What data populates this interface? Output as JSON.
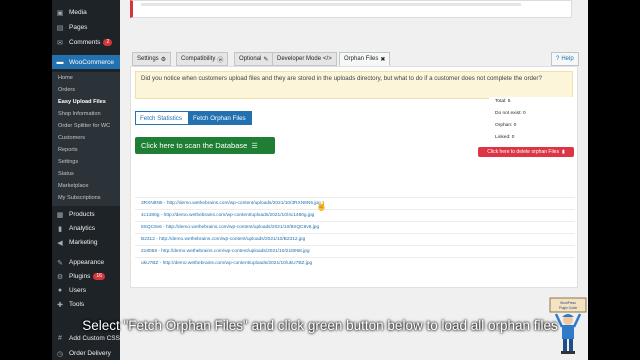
{
  "sidebar": {
    "items": [
      {
        "label": "Media",
        "icon": "media-icon"
      },
      {
        "label": "Pages",
        "icon": "pages-icon"
      },
      {
        "label": "Comments",
        "icon": "comments-icon",
        "badge": "2"
      },
      {
        "label": "WooCommerce",
        "icon": "woocommerce-icon"
      },
      {
        "label": "Products",
        "icon": "products-icon"
      },
      {
        "label": "Analytics",
        "icon": "analytics-icon"
      },
      {
        "label": "Marketing",
        "icon": "marketing-icon"
      },
      {
        "label": "Appearance",
        "icon": "appearance-icon"
      },
      {
        "label": "Plugins",
        "icon": "plugins-icon",
        "badge": "16"
      },
      {
        "label": "Users",
        "icon": "users-icon"
      },
      {
        "label": "Tools",
        "icon": "tools-icon"
      },
      {
        "label": "Add Custom CSS",
        "icon": "css-icon"
      },
      {
        "label": "Order Delivery",
        "icon": "delivery-icon"
      }
    ],
    "submenu": [
      "Home",
      "Orders",
      "Easy Upload Files",
      "Shop Information",
      "Order Splitter for WC",
      "Customers",
      "Reports",
      "Settings",
      "Status",
      "Marketplace",
      "My Subscriptions"
    ]
  },
  "tabs": [
    {
      "label": "Settings",
      "icon": "settings-gear-icon"
    },
    {
      "label": "Compatibility",
      "icon": "wordpress-icon"
    },
    {
      "label": "Optional",
      "icon": "edit-icon"
    },
    {
      "label": "Developer Mode",
      "icon": "code-icon"
    },
    {
      "label": "Orphan Files",
      "icon": "crossed-file-icon"
    }
  ],
  "help_label": "Help",
  "notice": "Did you notice when customers upload files and they are stored in the uploads directory, but what to do if a customer does not complete the order?",
  "subtabs": {
    "stats": "Fetch Statistics",
    "orphan": "Fetch Orphan Files"
  },
  "scan_button": "Click here to scan the Database",
  "stats": {
    "total": "Total: 5",
    "not_exist": "Do not exist: 0",
    "orphan": "Orphan: 0",
    "linked": "Linked: 0"
  },
  "delete_button": "Click here to delete orphan Files",
  "files": [
    "3RXN8N5 - http://demo.wethebrains.com/wp-content/uploads/2021/10/3RXN8N5.jpg",
    "4c1480g - http://demo.wethebrains.com/wp-content/uploads/2021/10/4c1480g.jpg",
    "8SQC8v6 - http://demo.wethebrains.com/wp-content/uploads/2021/10/8SQC8v6.jpg",
    "B2312 - http://demo.wethebrains.com/wp-content/uploads/2021/10/B2312.jpg",
    "218058 - http://demo.wethebrains.com/wp-content/uploads/2021/10/218058.jpg",
    "ukU7BZ - http://demo.wethebrains.com/wp-content/uploads/2021/10/ukU7BZ.jpg"
  ],
  "caption": "Select \"Fetch Orphan Files\" and click green button below to load all orphan files",
  "mascot_text": "WordPress Plugin Guide",
  "colors": {
    "accent": "#2271b1",
    "green": "#1e7e34",
    "red": "#dc3545",
    "sidebar": "#1d2327"
  }
}
